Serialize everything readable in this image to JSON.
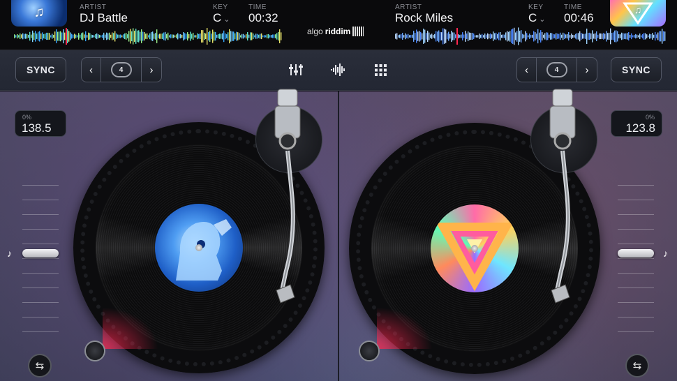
{
  "deck_left": {
    "artist_label": "ARTIST",
    "artist": "DJ Battle",
    "key_label": "KEY",
    "key": "C",
    "time_label": "TIME",
    "time": "00:32",
    "sync_label": "SYNC",
    "loop_value": "4",
    "pitch_percent": "0%",
    "bpm": "138.5",
    "icons": {
      "album_art": "music-note-icon",
      "prev": "chevron-left-icon",
      "next": "chevron-right-icon",
      "loop": "loop-icon",
      "tempo_mode": "music-note-icon",
      "cue": "cue-icon"
    }
  },
  "deck_right": {
    "artist_label": "ARTIST",
    "artist": "Rock Miles",
    "key_label": "KEY",
    "key": "C",
    "time_label": "TIME",
    "time": "00:46",
    "sync_label": "SYNC",
    "loop_value": "4",
    "pitch_percent": "0%",
    "bpm": "123.8",
    "icons": {
      "album_art": "music-note-icon",
      "prev": "chevron-left-icon",
      "next": "chevron-right-icon",
      "loop": "loop-icon",
      "tempo_mode": "music-note-icon",
      "cue": "cue-icon"
    }
  },
  "brand": {
    "prefix": "algo",
    "bold": "riddim"
  },
  "center_icons": [
    "mixer-icon",
    "waveform-icon",
    "grid-icon"
  ],
  "colors": {
    "background": "#000000",
    "strip": "#2a2e3a",
    "accent_red": "#ff2850"
  }
}
